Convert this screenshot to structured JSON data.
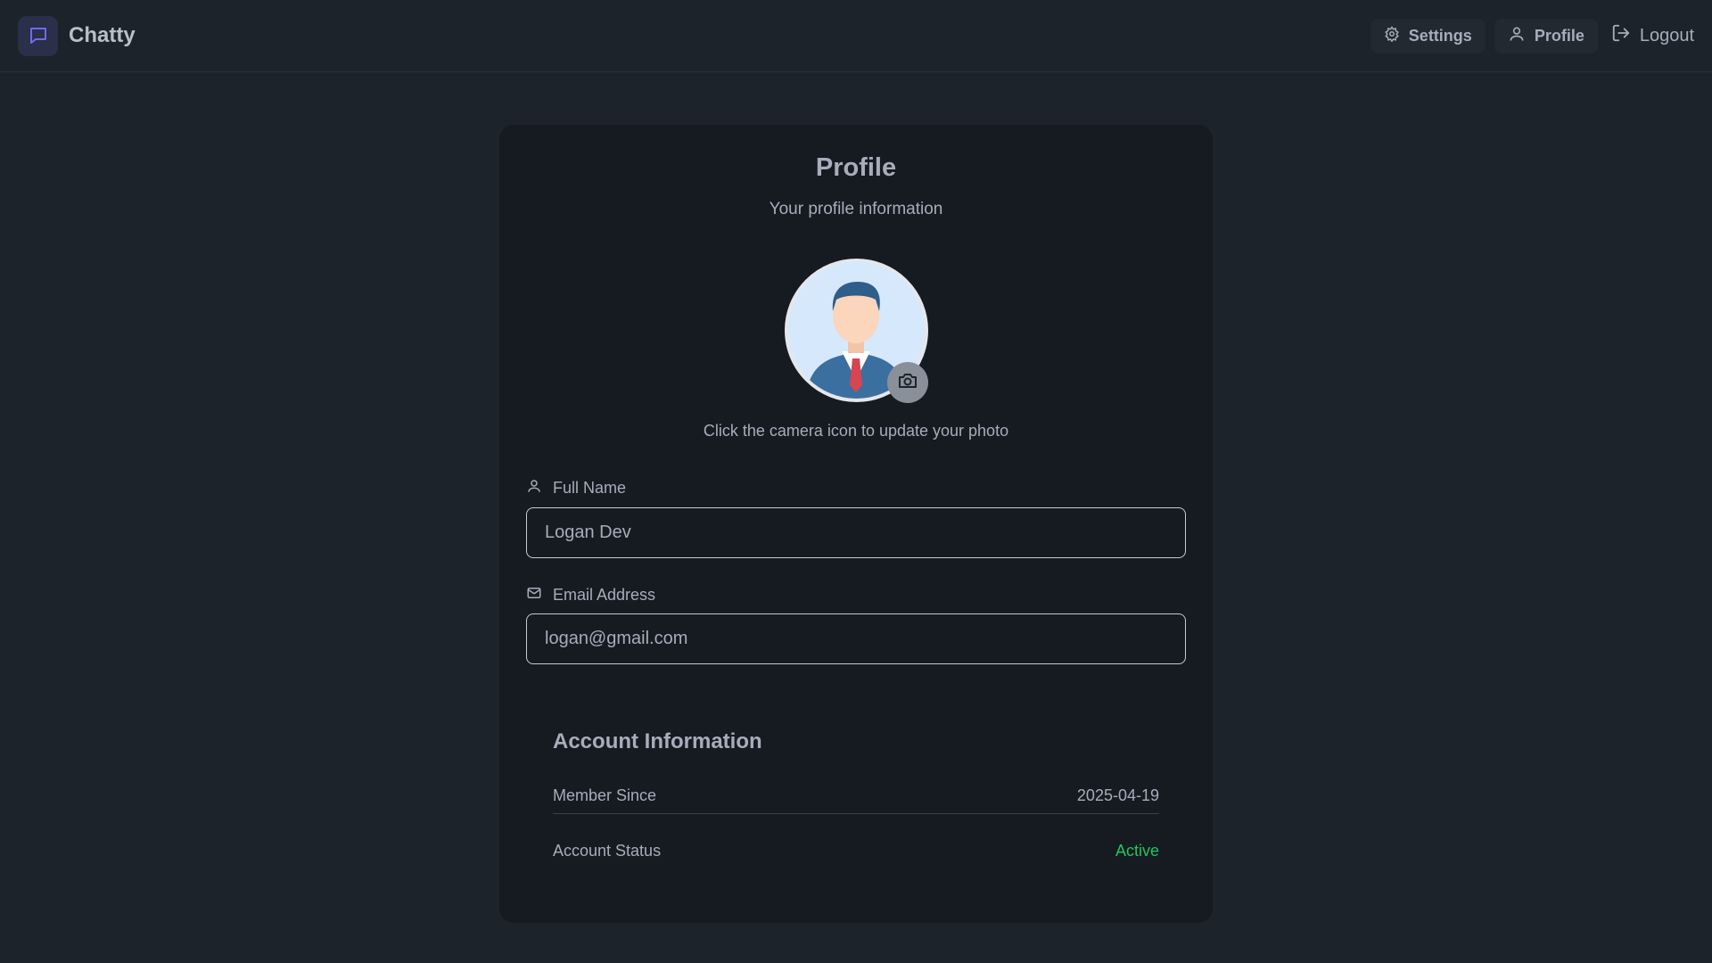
{
  "app": {
    "name": "Chatty"
  },
  "nav": {
    "settings_label": "Settings",
    "profile_label": "Profile",
    "logout_label": "Logout"
  },
  "profile": {
    "title": "Profile",
    "subtitle": "Your profile information",
    "avatar_hint": "Click the camera icon to update your photo"
  },
  "fields": {
    "full_name": {
      "label": "Full Name",
      "value": "Logan Dev"
    },
    "email": {
      "label": "Email Address",
      "value": "logan@gmail.com"
    }
  },
  "account": {
    "title": "Account Information",
    "member_since_label": "Member Since",
    "member_since_value": "2025-04-19",
    "status_label": "Account Status",
    "status_value": "Active"
  },
  "colors": {
    "background": "#1d232a",
    "card": "#161b21",
    "accent": "#6d6bf0",
    "status_active": "#22c55e"
  },
  "icons": {
    "logo": "chat-bubble-icon",
    "settings": "gear-icon",
    "profile": "user-icon",
    "logout": "logout-icon",
    "camera": "camera-icon",
    "full_name": "user-icon",
    "email": "mail-icon"
  }
}
